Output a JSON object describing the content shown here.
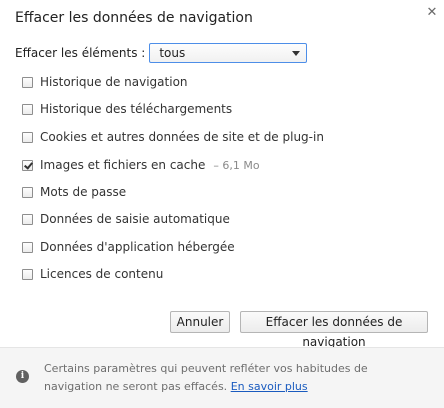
{
  "dialog": {
    "title": "Effacer les données de navigation",
    "close_icon": "close-icon"
  },
  "range": {
    "label": "Effacer les éléments :",
    "selected": "tous"
  },
  "options": [
    {
      "label": "Historique de navigation",
      "checked": false
    },
    {
      "label": "Historique des téléchargements",
      "checked": false
    },
    {
      "label": "Cookies et autres données de site et de plug-in",
      "checked": false
    },
    {
      "label": "Images et fichiers en cache",
      "checked": true,
      "extra": "– 6,1 Mo"
    },
    {
      "label": "Mots de passe",
      "checked": false
    },
    {
      "label": "Données de saisie automatique",
      "checked": false
    },
    {
      "label": "Données d'application hébergée",
      "checked": false
    },
    {
      "label": "Licences de contenu",
      "checked": false
    }
  ],
  "buttons": {
    "cancel": "Annuler",
    "clear": "Effacer les données de navigation"
  },
  "footer": {
    "icon": "info-icon",
    "text": "Certains paramètres qui peuvent refléter vos habitudes de navigation ne seront pas effacés.",
    "link": "En savoir plus"
  }
}
